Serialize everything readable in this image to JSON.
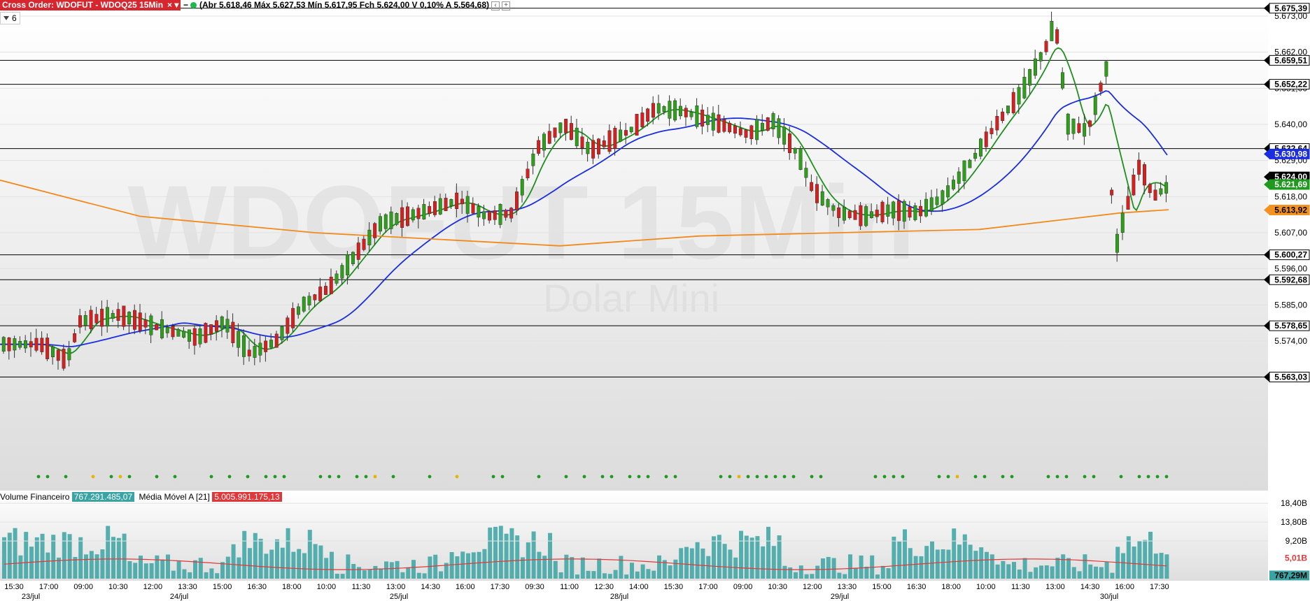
{
  "header": {
    "cross_order": "Cross Order: WDOFUT - WDOQ25 15Min",
    "close_symbol": "×",
    "ohlc_text": "(Abr 5.618,46 Máx 5.627,53 Mín 5.617,95 Fch 5.624,00 V 0,10% A 5.564,68)",
    "minus_symbol": "−"
  },
  "period_selector": {
    "value": "6"
  },
  "watermark": {
    "symbol": "WDOFUT 15Min",
    "name": "Dolar Mini"
  },
  "price_axis": {
    "ticks": [
      "5.673,00",
      "5.662,00",
      "5.651,00",
      "5.640,00",
      "5.629,00",
      "5.618,00",
      "5.607,00",
      "5.596,00",
      "5.585,00",
      "5.574,00"
    ],
    "labels": [
      {
        "text": "5.675,39",
        "price": 5675.39,
        "bg": "#ffffff",
        "fg": "#000000",
        "kind": "level"
      },
      {
        "text": "5.659,51",
        "price": 5659.51,
        "bg": "#ffffff",
        "fg": "#000000",
        "kind": "level"
      },
      {
        "text": "5.652,22",
        "price": 5652.22,
        "bg": "#ffffff",
        "fg": "#000000",
        "kind": "level"
      },
      {
        "text": "5.632,64",
        "price": 5632.64,
        "bg": "#ffffff",
        "fg": "#000000",
        "kind": "level"
      },
      {
        "text": "5.630,98",
        "price": 5630.98,
        "bg": "#1a2ee0",
        "fg": "#ffffff",
        "kind": "indicator"
      },
      {
        "text": "5.624,00",
        "price": 5624.0,
        "bg": "#000000",
        "fg": "#ffffff",
        "kind": "last"
      },
      {
        "text": "5.621,69",
        "price": 5621.69,
        "bg": "#1f9a1f",
        "fg": "#ffffff",
        "kind": "indicator"
      },
      {
        "text": "5.613,92",
        "price": 5613.92,
        "bg": "#f39220",
        "fg": "#000000",
        "kind": "indicator"
      },
      {
        "text": "5.600,27",
        "price": 5600.27,
        "bg": "#ffffff",
        "fg": "#000000",
        "kind": "level"
      },
      {
        "text": "5.592,68",
        "price": 5592.68,
        "bg": "#ffffff",
        "fg": "#000000",
        "kind": "level"
      },
      {
        "text": "5.578,65",
        "price": 5578.65,
        "bg": "#ffffff",
        "fg": "#000000",
        "kind": "level"
      },
      {
        "text": "5.563,03",
        "price": 5563.03,
        "bg": "#ffffff",
        "fg": "#000000",
        "kind": "level"
      }
    ],
    "range": [
      5562,
      5676
    ]
  },
  "volume_panel": {
    "title": "Volume Financeiro",
    "value": "767.291.485,07",
    "ma_title": "Média Móvel A [21]",
    "ma_value": "5.005.991.175,13",
    "ticks": [
      "18,40B",
      "13,80B",
      "9,20B"
    ],
    "labels": [
      {
        "text": "5,01B",
        "value": 5.01,
        "bg": "#ffffff",
        "fg": "#e0383a"
      },
      {
        "text": "767,29M",
        "value": 0.77,
        "bg": "#3aa3a3",
        "fg": "#000000"
      }
    ],
    "range": [
      0,
      21
    ]
  },
  "time_axis": {
    "labels": [
      "15:30",
      "17:00",
      "09:00",
      "10:30",
      "12:00",
      "13:30",
      "15:00",
      "16:30",
      "18:00",
      "10:00",
      "11:30",
      "13:00",
      "14:30",
      "16:00",
      "17:30",
      "09:30",
      "11:00",
      "12:30",
      "14:00",
      "15:30",
      "17:00",
      "09:00",
      "10:30",
      "12:00",
      "13:30",
      "15:00",
      "16:30",
      "18:00",
      "10:00",
      "11:30",
      "13:00",
      "14:30",
      "16:00",
      "17:30"
    ],
    "dates": [
      "23/jul",
      "24/jul",
      "25/jul",
      "28/jul",
      "29/jul",
      "30/jul"
    ]
  },
  "chart_data": {
    "type": "candlestick",
    "price_levels": [
      5675.39,
      5659.51,
      5652.22,
      5632.64,
      5600.27,
      5592.68,
      5578.65,
      5563.03
    ],
    "last_close": 5624.0,
    "open": 5618.46,
    "high": 5627.53,
    "low": 5617.95,
    "close": 5624.0,
    "indicators": {
      "blue_ma": 5630.98,
      "green_ma": 5621.69,
      "orange_ma": 5613.92
    },
    "colors": {
      "up": "#2f9e1a",
      "down": "#d61f1f",
      "blue": "#1a2ee0",
      "green": "#1f8f1f",
      "orange": "#f08a1c",
      "volume": "#3aa3a3",
      "volume_ma": "#e0383a"
    }
  }
}
